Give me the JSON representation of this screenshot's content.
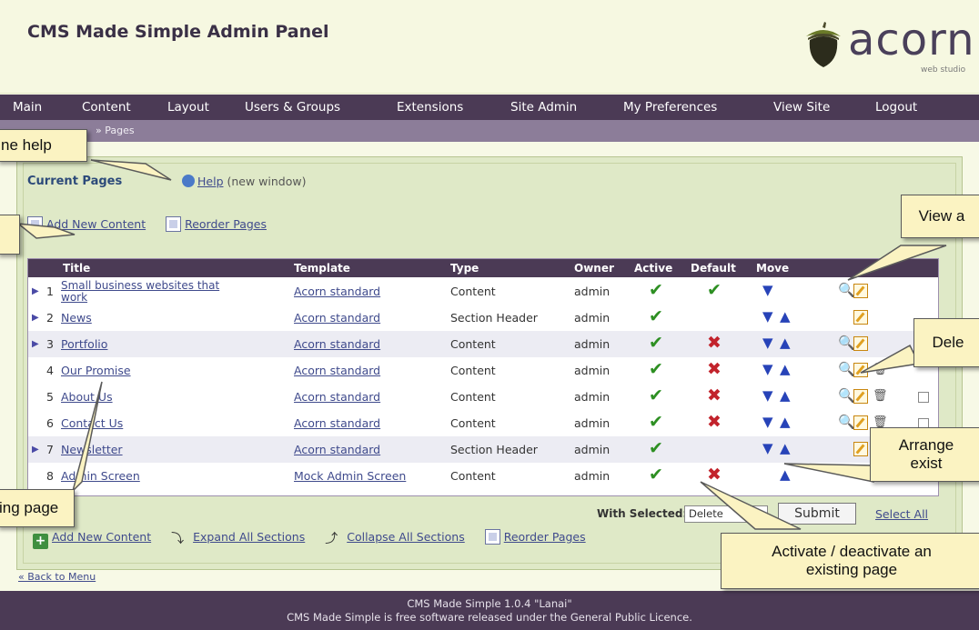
{
  "header": {
    "title": "CMS Made Simple Admin Panel",
    "logo_text": "acorn",
    "logo_sub": "web studio"
  },
  "nav": [
    "Main",
    "Content",
    "Layout",
    "Users & Groups",
    "Extensions",
    "Site Admin",
    "My Preferences",
    "View Site",
    "Logout"
  ],
  "breadcrumb": "» Pages",
  "section": {
    "heading": "Current Pages",
    "help_link": "Help",
    "help_suffix": "(new window)"
  },
  "top_toolbar": {
    "add": "Add New Content",
    "reorder": "Reorder Pages"
  },
  "table": {
    "columns": [
      "Title",
      "Template",
      "Type",
      "Owner",
      "Active",
      "Default",
      "Move"
    ],
    "rows": [
      {
        "num": "1",
        "title_line1": "Small business websites that",
        "title_line2": "work",
        "template": "Acorn standard",
        "type": "Content",
        "owner": "admin"
      },
      {
        "num": "2",
        "title_line1": "News",
        "title_line2": "",
        "template": "Acorn standard",
        "type": "Section Header",
        "owner": "admin"
      },
      {
        "num": "3",
        "title_line1": "Portfolio",
        "title_line2": "",
        "template": "Acorn standard",
        "type": "Content",
        "owner": "admin"
      },
      {
        "num": "4",
        "title_line1": "Our Promise",
        "title_line2": "",
        "template": "Acorn standard",
        "type": "Content",
        "owner": "admin"
      },
      {
        "num": "5",
        "title_line1": "About Us",
        "title_line2": "",
        "template": "Acorn standard",
        "type": "Content",
        "owner": "admin"
      },
      {
        "num": "6",
        "title_line1": "Contact Us",
        "title_line2": "",
        "template": "Acorn standard",
        "type": "Content",
        "owner": "admin"
      },
      {
        "num": "7",
        "title_line1": "Newsletter",
        "title_line2": "",
        "template": "Acorn standard",
        "type": "Section Header",
        "owner": "admin"
      },
      {
        "num": "8",
        "title_line1": "Admin Screen",
        "title_line2": "",
        "template": "Mock Admin Screen",
        "type": "Content",
        "owner": "admin"
      }
    ]
  },
  "bulk": {
    "with_selected": "With Selected:",
    "select_value": "Delete",
    "submit": "Submit",
    "select_all": "Select All"
  },
  "bottom_toolbar": {
    "add": "Add New Content",
    "expand": "Expand All Sections",
    "collapse": "Collapse All Sections",
    "reorder": "Reorder Pages"
  },
  "back_link": "« Back to Menu",
  "footer": {
    "line1": "CMS Made Simple 1.0.4 \"Lanai\"",
    "line2": "CMS Made Simple is free software released under the General Public Licence."
  },
  "callouts": {
    "help": "ne help",
    "view": "View a",
    "delete": "Dele",
    "arrange_1": "Arrange",
    "arrange_2": "exist",
    "editing": "ing page",
    "activate_1": "Activate / deactivate an",
    "activate_2": "existing page"
  }
}
